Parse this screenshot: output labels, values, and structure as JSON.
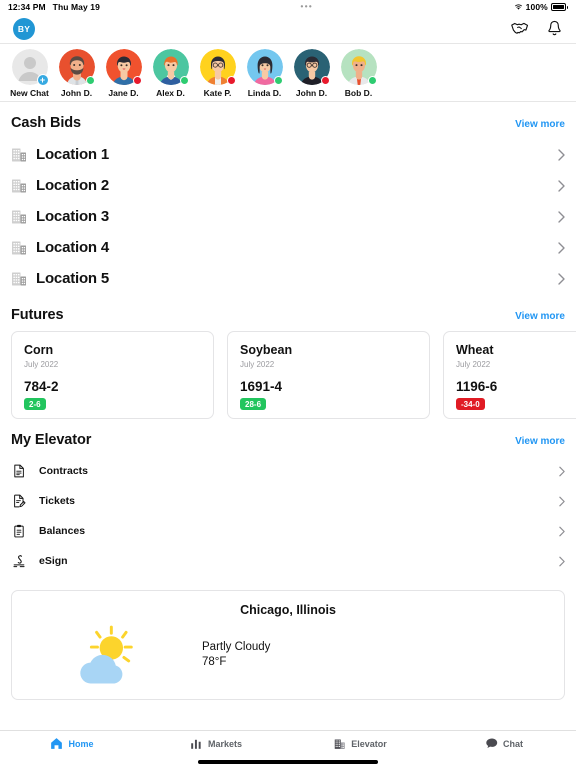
{
  "status_bar": {
    "time": "12:34 PM",
    "date": "Thu May 19",
    "center_dots": "•••",
    "battery_percent": "100%",
    "wifi_icon": "wifi-icon",
    "battery_icon": "battery-full-icon"
  },
  "app_bar": {
    "avatar_initials": "BY",
    "handshake_icon": "handshake-icon",
    "bell_icon": "bell-icon"
  },
  "chat_strip": {
    "items": [
      {
        "name": "New Chat",
        "type": "new",
        "status": "none",
        "bg": "#e8e8e8",
        "skin": "#c9c9c9"
      },
      {
        "name": "John D.",
        "type": "person",
        "status": "online",
        "bg": "#e8502e",
        "hair": "#5b4a42",
        "skin": "#f0b08a",
        "shirt": "#dfe3e6"
      },
      {
        "name": "Jane D.",
        "type": "person",
        "status": "busy",
        "bg": "#f0522e",
        "hair": "#2b2b34",
        "skin": "#f7c9a4",
        "shirt": "#2f6fa8"
      },
      {
        "name": "Alex D.",
        "type": "person",
        "status": "online",
        "bg": "#4cc6a0",
        "hair": "#e8702a",
        "skin": "#f7c9a4",
        "shirt": "#2f5fa0"
      },
      {
        "name": "Kate P.",
        "type": "person",
        "status": "busy",
        "bg": "#ffd21e",
        "hair": "#2b2b34",
        "skin": "#f7c9a4",
        "shirt": "#ef8033"
      },
      {
        "name": "Linda D.",
        "type": "person",
        "status": "online",
        "bg": "#74c7ef",
        "hair": "#2b2b34",
        "skin": "#f7c9a4",
        "shirt": "#f06aa0"
      },
      {
        "name": "John D.",
        "type": "person",
        "status": "busy",
        "bg": "#2a6274",
        "hair": "#2b2b34",
        "skin": "#f7c9a4",
        "shirt": "#1f1f28"
      },
      {
        "name": "Bob D.",
        "type": "person",
        "status": "online",
        "bg": "#b6e2c0",
        "hair": "#f2c42e",
        "skin": "#f0b08a",
        "shirt": "#e8e8ea"
      }
    ]
  },
  "cash_bids": {
    "title": "Cash Bids",
    "view_more": "View more",
    "locations": [
      {
        "label": "Location 1",
        "icon": "building-icon"
      },
      {
        "label": "Location 2",
        "icon": "building-icon"
      },
      {
        "label": "Location 3",
        "icon": "building-icon"
      },
      {
        "label": "Location 4",
        "icon": "building-icon"
      },
      {
        "label": "Location 5",
        "icon": "building-icon"
      }
    ]
  },
  "futures": {
    "title": "Futures",
    "view_more": "View more",
    "cards": [
      {
        "name": "Corn",
        "month": "July 2022",
        "price": "784-2",
        "change": "2-6",
        "direction": "up"
      },
      {
        "name": "Soybean",
        "month": "July 2022",
        "price": "1691-4",
        "change": "28-6",
        "direction": "up"
      },
      {
        "name": "Wheat",
        "month": "July 2022",
        "price": "1196-6",
        "change": "-34-0",
        "direction": "down"
      }
    ]
  },
  "my_elevator": {
    "title": "My Elevator",
    "view_more": "View more",
    "items": [
      {
        "label": "Contracts",
        "icon": "document-icon"
      },
      {
        "label": "Tickets",
        "icon": "document-edit-icon"
      },
      {
        "label": "Balances",
        "icon": "clipboard-icon"
      },
      {
        "label": "eSign",
        "icon": "signature-icon"
      }
    ]
  },
  "weather": {
    "city": "Chicago, Illinois",
    "condition": "Partly Cloudy",
    "temperature": "78°F",
    "icon": "partly-cloudy-icon"
  },
  "tab_bar": {
    "tabs": [
      {
        "label": "Home",
        "icon": "home-icon",
        "active": true
      },
      {
        "label": "Markets",
        "icon": "bar-chart-icon",
        "active": false
      },
      {
        "label": "Elevator",
        "icon": "building-icon",
        "active": false
      },
      {
        "label": "Chat",
        "icon": "chat-icon",
        "active": false
      }
    ]
  },
  "colors": {
    "accent": "#2196f3",
    "avatar_blue": "#2196d4",
    "up_green": "#22c55e",
    "down_red": "#e01b24",
    "online": "#2ecc71",
    "busy": "#e8192c"
  }
}
